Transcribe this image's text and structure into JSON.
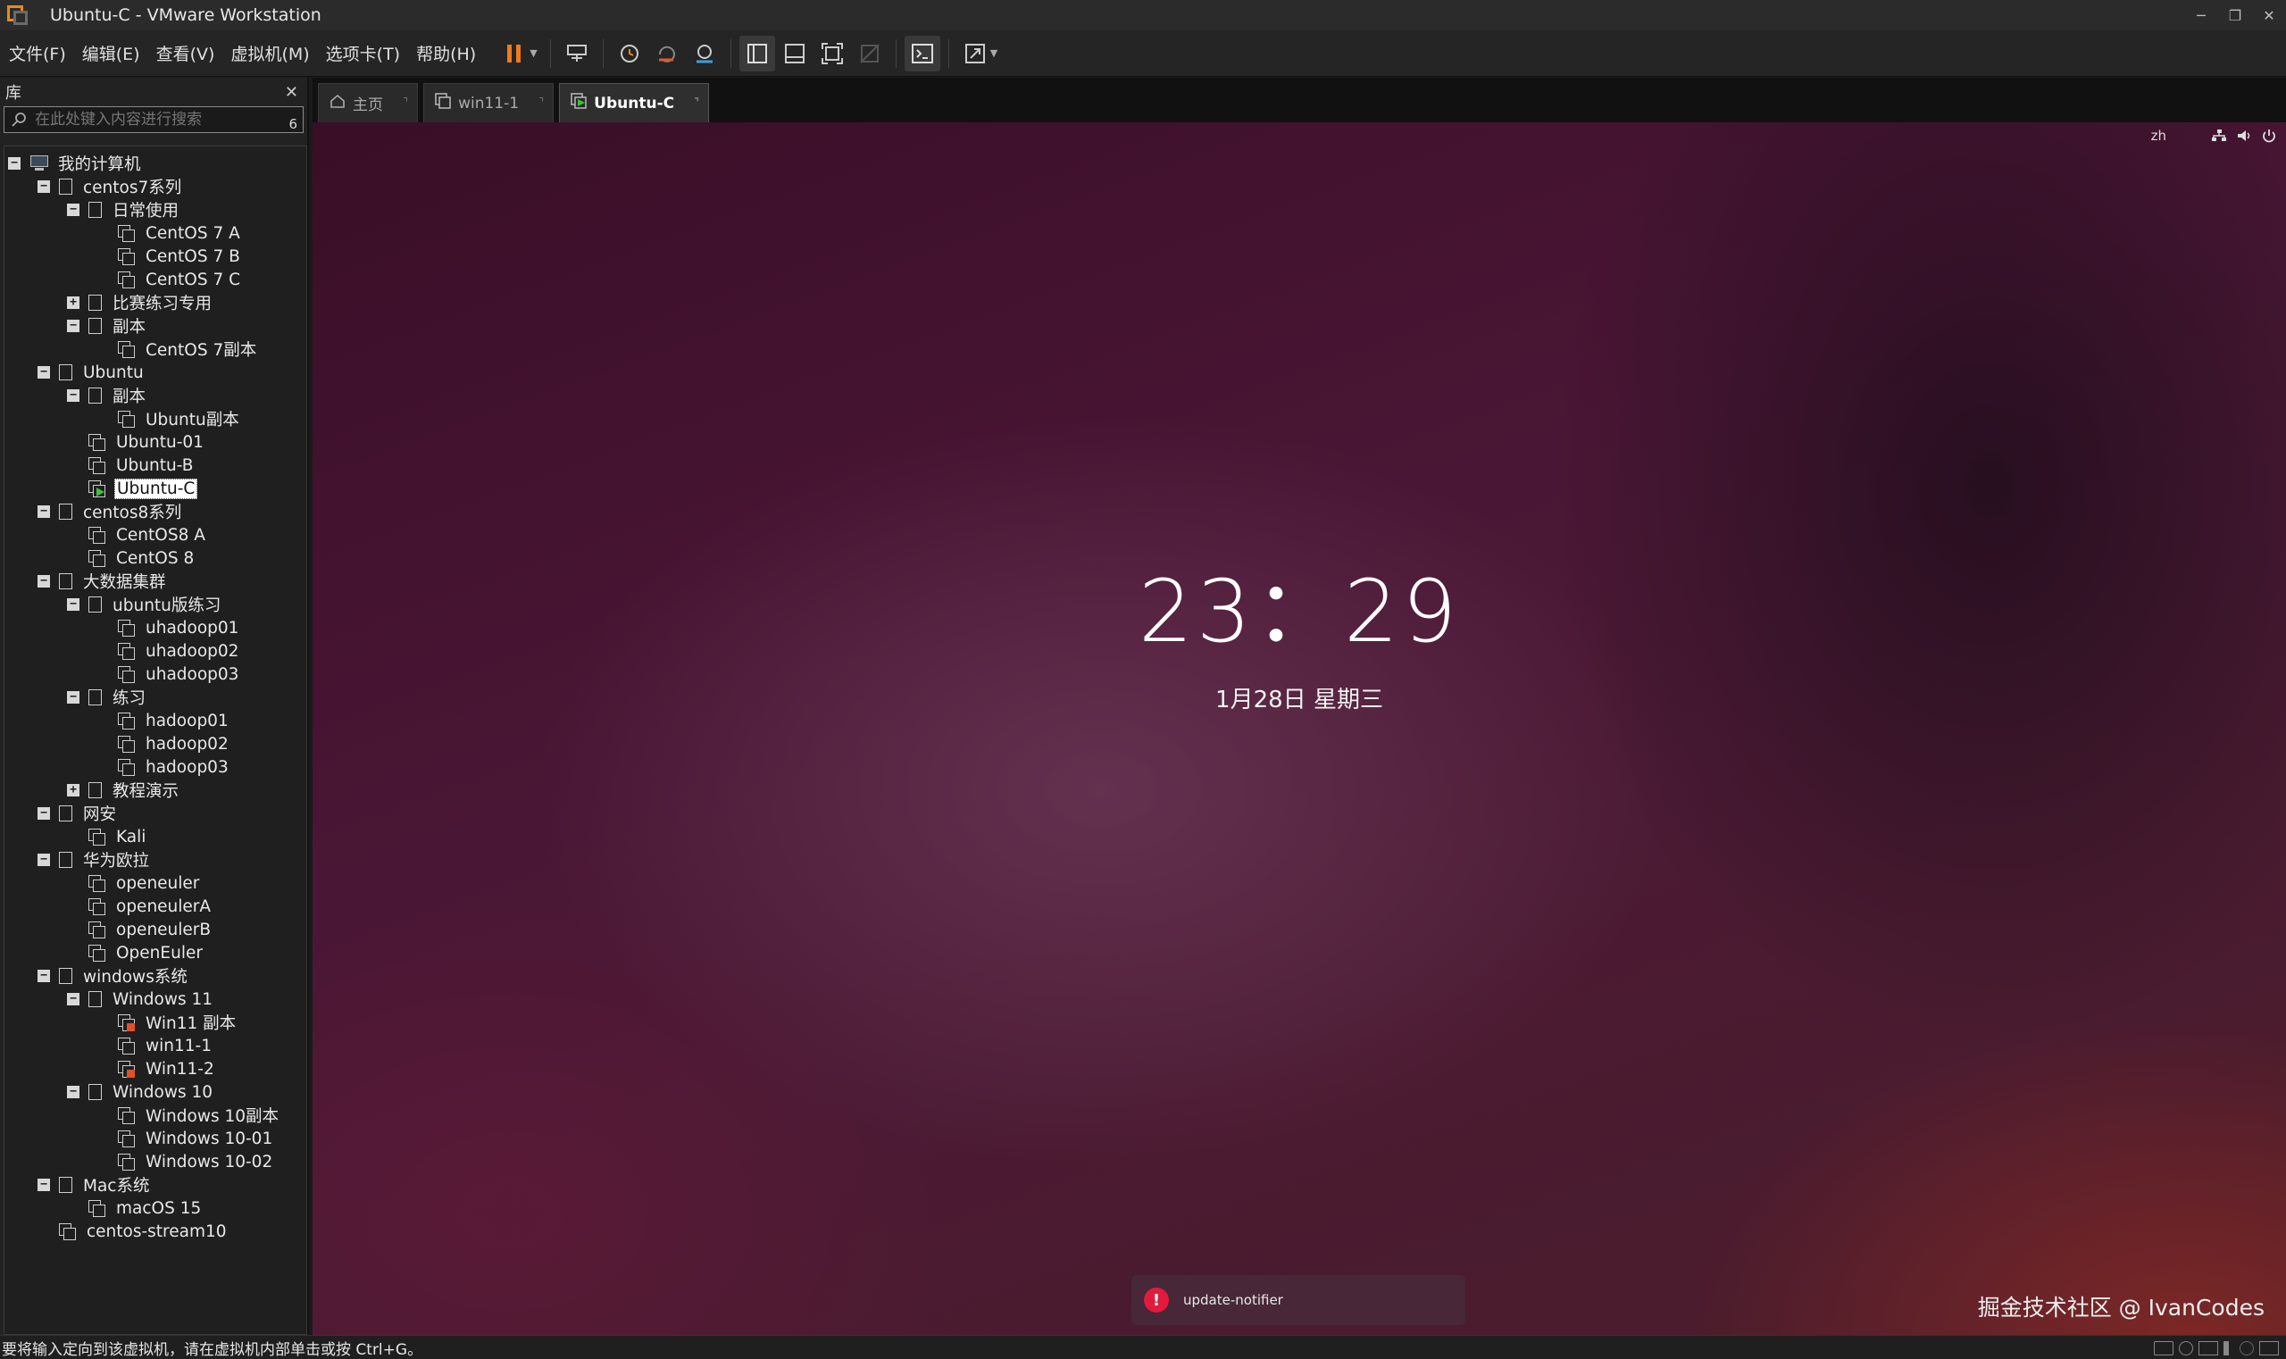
{
  "window": {
    "title": "Ubuntu-C - VMware Workstation"
  },
  "menu": [
    "文件(F)",
    "编辑(E)",
    "查看(V)",
    "虚拟机(M)",
    "选项卡(T)",
    "帮助(H)"
  ],
  "library": {
    "title": "库",
    "close": "✕",
    "search_placeholder": "在此处键入内容进行搜索",
    "search_count": "6"
  },
  "tree": [
    {
      "label": "我的计算机",
      "depth": 0,
      "kind": "computer",
      "exp": "−"
    },
    {
      "label": "centos7系列",
      "depth": 1,
      "kind": "folder",
      "exp": "−"
    },
    {
      "label": "日常使用",
      "depth": 2,
      "kind": "folder",
      "exp": "−"
    },
    {
      "label": "CentOS 7 A",
      "depth": 3,
      "kind": "vm"
    },
    {
      "label": "CentOS 7  B",
      "depth": 3,
      "kind": "vm"
    },
    {
      "label": "CentOS 7 C",
      "depth": 3,
      "kind": "vm"
    },
    {
      "label": "比赛练习专用",
      "depth": 2,
      "kind": "folder",
      "exp": "+"
    },
    {
      "label": "副本",
      "depth": 2,
      "kind": "folder",
      "exp": "−"
    },
    {
      "label": "CentOS 7副本",
      "depth": 3,
      "kind": "vm"
    },
    {
      "label": "Ubuntu",
      "depth": 1,
      "kind": "folder",
      "exp": "−"
    },
    {
      "label": "副本",
      "depth": 2,
      "kind": "folder",
      "exp": "−"
    },
    {
      "label": "Ubuntu副本",
      "depth": 3,
      "kind": "vm"
    },
    {
      "label": "Ubuntu-01",
      "depth": 2,
      "kind": "vm"
    },
    {
      "label": "Ubuntu-B",
      "depth": 2,
      "kind": "vm"
    },
    {
      "label": "Ubuntu-C",
      "depth": 2,
      "kind": "vm-running",
      "selected": true
    },
    {
      "label": "centos8系列",
      "depth": 1,
      "kind": "folder",
      "exp": "−"
    },
    {
      "label": "CentOS8 A",
      "depth": 2,
      "kind": "vm"
    },
    {
      "label": "CentOS 8",
      "depth": 2,
      "kind": "vm"
    },
    {
      "label": "大数据集群",
      "depth": 1,
      "kind": "folder",
      "exp": "−"
    },
    {
      "label": "ubuntu版练习",
      "depth": 2,
      "kind": "folder",
      "exp": "−"
    },
    {
      "label": "uhadoop01",
      "depth": 3,
      "kind": "vm"
    },
    {
      "label": "uhadoop02",
      "depth": 3,
      "kind": "vm"
    },
    {
      "label": "uhadoop03",
      "depth": 3,
      "kind": "vm"
    },
    {
      "label": "练习",
      "depth": 2,
      "kind": "folder",
      "exp": "−"
    },
    {
      "label": "hadoop01",
      "depth": 3,
      "kind": "vm"
    },
    {
      "label": "hadoop02",
      "depth": 3,
      "kind": "vm"
    },
    {
      "label": "hadoop03",
      "depth": 3,
      "kind": "vm"
    },
    {
      "label": "教程演示",
      "depth": 2,
      "kind": "folder",
      "exp": "+"
    },
    {
      "label": "网安",
      "depth": 1,
      "kind": "folder",
      "exp": "−"
    },
    {
      "label": "Kali",
      "depth": 2,
      "kind": "vm"
    },
    {
      "label": "华为欧拉",
      "depth": 1,
      "kind": "folder",
      "exp": "−"
    },
    {
      "label": "openeuler",
      "depth": 2,
      "kind": "vm"
    },
    {
      "label": "openeulerA",
      "depth": 2,
      "kind": "vm"
    },
    {
      "label": "openeulerB",
      "depth": 2,
      "kind": "vm"
    },
    {
      "label": "OpenEuler",
      "depth": 2,
      "kind": "vm"
    },
    {
      "label": "windows系统",
      "depth": 1,
      "kind": "folder",
      "exp": "−"
    },
    {
      "label": "Windows 11",
      "depth": 2,
      "kind": "folder",
      "exp": "−"
    },
    {
      "label": "Win11 副本",
      "depth": 3,
      "kind": "vm-locked"
    },
    {
      "label": "win11-1",
      "depth": 3,
      "kind": "vm"
    },
    {
      "label": "Win11-2",
      "depth": 3,
      "kind": "vm-locked"
    },
    {
      "label": "Windows 10",
      "depth": 2,
      "kind": "folder",
      "exp": "−"
    },
    {
      "label": "Windows 10副本",
      "depth": 3,
      "kind": "vm"
    },
    {
      "label": "Windows 10-01",
      "depth": 3,
      "kind": "vm"
    },
    {
      "label": "Windows 10-02",
      "depth": 3,
      "kind": "vm"
    },
    {
      "label": "Mac系统",
      "depth": 1,
      "kind": "folder",
      "exp": "−"
    },
    {
      "label": "macOS 15",
      "depth": 2,
      "kind": "vm"
    },
    {
      "label": "centos-stream10",
      "depth": 1,
      "kind": "vm"
    }
  ],
  "tabs": [
    {
      "label": "主页",
      "icon": "home-icon",
      "active": false
    },
    {
      "label": "win11-1",
      "icon": "vm-icon",
      "active": false
    },
    {
      "label": "Ubuntu-C",
      "icon": "vm-running-icon",
      "active": true
    }
  ],
  "vm": {
    "lang": "zh",
    "clock": "23：29",
    "date": "1月28日 星期三",
    "notification": "update-notifier",
    "watermark": "掘金技术社区 @ IvanCodes"
  },
  "status": {
    "message": "要将输入定向到该虚拟机，请在虚拟机内部单击或按 Ctrl+G。"
  },
  "colors": {
    "accent": "#e98a1c",
    "pause": "#f07a1a",
    "running": "#3cc43c",
    "alert": "#e01b3c"
  }
}
